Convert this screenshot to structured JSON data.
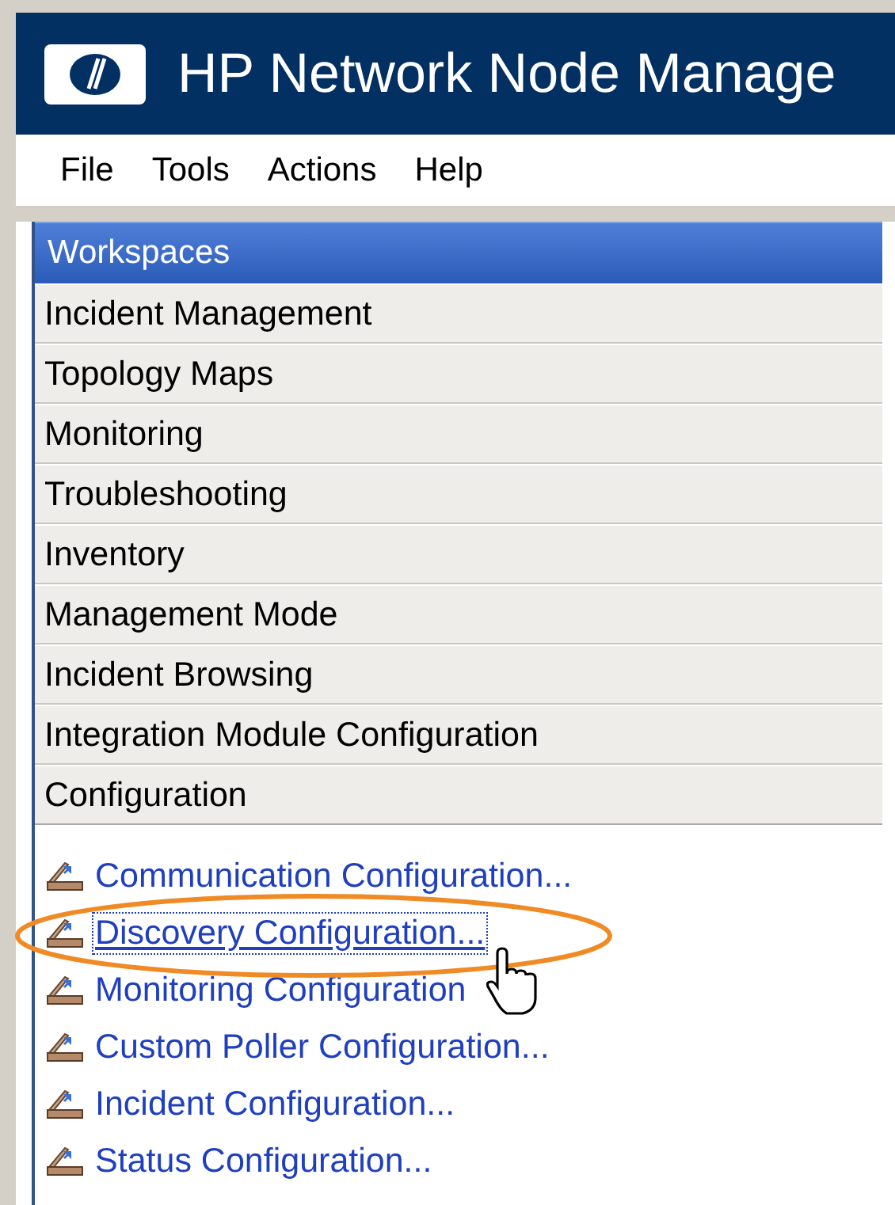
{
  "header": {
    "title": "HP Network Node Manage"
  },
  "menu": [
    "File",
    "Tools",
    "Actions",
    "Help"
  ],
  "workspaces": {
    "title": "Workspaces",
    "items": [
      {
        "label": "Incident Management",
        "expanded": false
      },
      {
        "label": "Topology Maps",
        "expanded": false
      },
      {
        "label": "Monitoring",
        "expanded": false
      },
      {
        "label": "Troubleshooting",
        "expanded": false
      },
      {
        "label": "Inventory",
        "expanded": false
      },
      {
        "label": "Management Mode",
        "expanded": false
      },
      {
        "label": "Incident Browsing",
        "expanded": false
      },
      {
        "label": "Integration Module Configuration",
        "expanded": false
      },
      {
        "label": "Configuration",
        "expanded": true,
        "children": [
          {
            "label": "Communication Configuration...",
            "selected": false
          },
          {
            "label": "Discovery Configuration...",
            "selected": true
          },
          {
            "label": "Monitoring Configuration",
            "selected": false
          },
          {
            "label": "Custom Poller Configuration...",
            "selected": false
          },
          {
            "label": "Incident Configuration...",
            "selected": false
          },
          {
            "label": "Status Configuration...",
            "selected": false
          }
        ]
      }
    ]
  }
}
